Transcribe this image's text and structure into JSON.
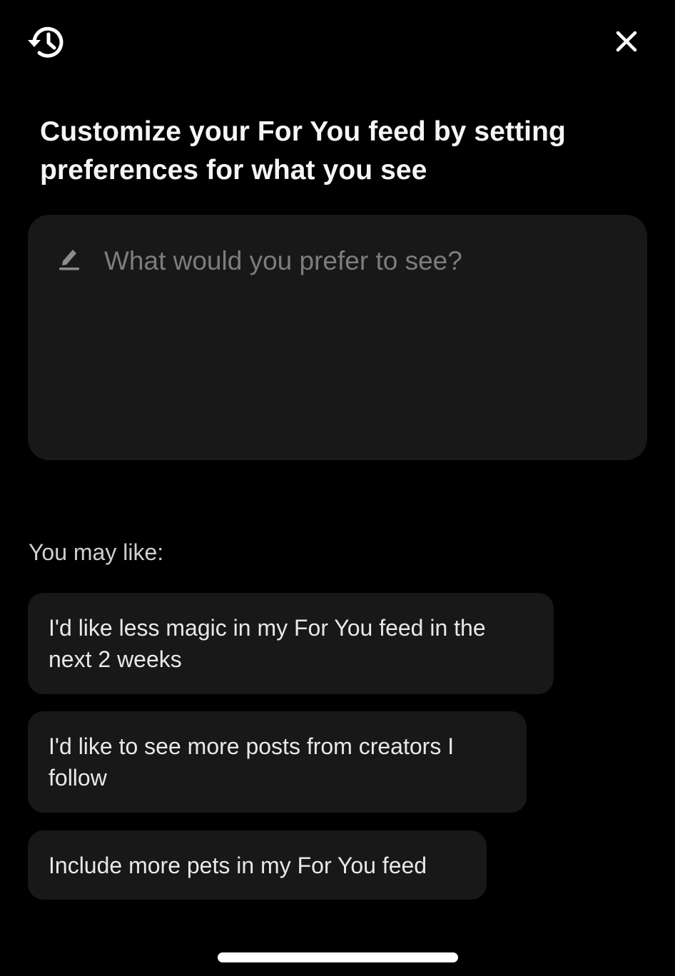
{
  "header": {
    "history_icon": "history-clock-icon",
    "close_icon": "close-icon"
  },
  "title": "Customize your For You feed by setting preferences for what you see",
  "preference_input": {
    "icon": "pencil-icon",
    "value": "",
    "placeholder": "What would you prefer to see?"
  },
  "suggestions": {
    "label": "You may like:",
    "items": [
      "I'd like less magic in my For You feed in the next 2 weeks",
      "I'd like to see more posts from creators I follow",
      "Include more pets in my For You feed"
    ]
  },
  "colors": {
    "background": "#000000",
    "surface": "#181818",
    "text_primary": "#ffffff",
    "placeholder": "#7d7d7d"
  }
}
